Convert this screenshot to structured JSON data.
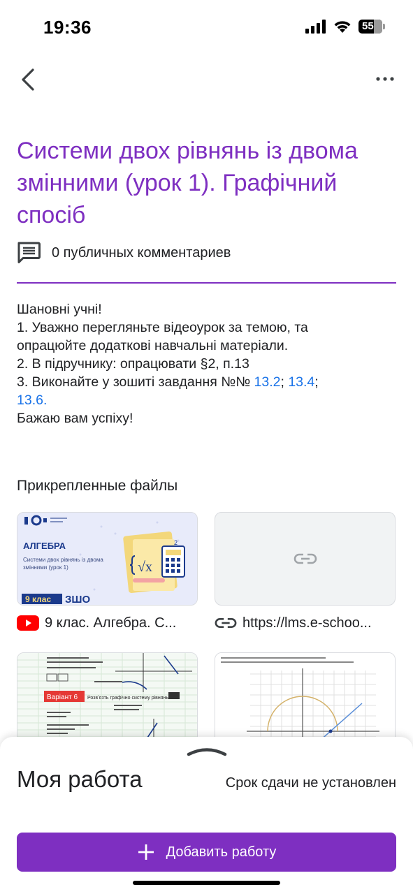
{
  "status": {
    "time": "19:36",
    "battery": "55"
  },
  "assignment": {
    "title": "Системи двох рівнянь із двома змінними (урок 1). Графічний спосіб",
    "comments": "0 публичных комментариев"
  },
  "description": {
    "greeting": "Шановні учні!",
    "step1a": "1. Уважно перегляньте  відеоурок за темою, та",
    "step1b": "опрацюйте додаткові навчальні матеріали.",
    "step2": "2. В підручнику: опрацювати §2, п.13",
    "step3_prefix": "3. Виконайте у зошиті завдання №№ ",
    "link1": "13.2",
    "sep1": "; ",
    "link2": "13.4",
    "sep2": ";",
    "link3": "13.6.",
    "closing": "Бажаю вам успіху!"
  },
  "files": {
    "heading": "Прикрепленные файлы",
    "items": [
      {
        "caption": "9 клас. Алгебра. С...",
        "thumb_heading": "АЛГЕБРА",
        "thumb_sub1": "Системи двох рівнянь із двома",
        "thumb_sub2": "змінними (урок 1)",
        "thumb_badge": "9 клас",
        "thumb_brand": "ЗШО"
      },
      {
        "caption": "https://lms.e-schoo..."
      },
      {
        "doc_header": "Варіант 6",
        "doc_text": "Розвʼязть графічно систему рівнянь"
      },
      {}
    ]
  },
  "my_work": {
    "title": "Моя работа",
    "due": "Срок сдачи не установлен",
    "add_button": "Добавить работу"
  },
  "colors": {
    "accent": "#7e2fc1",
    "link": "#1a73e8",
    "youtube": "#ff0000"
  }
}
